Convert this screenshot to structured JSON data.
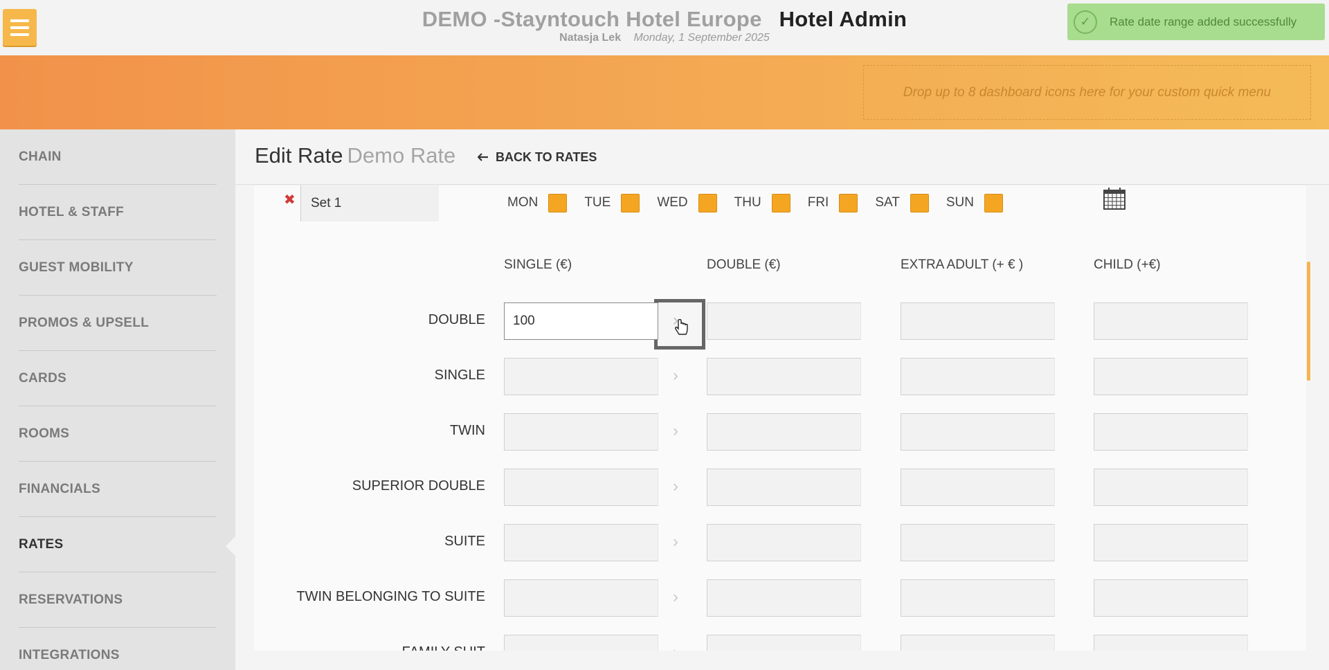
{
  "header": {
    "hotel_name": "DEMO -Stayntouch Hotel Europe",
    "app_title": "Hotel Admin",
    "user": "Natasja Lek",
    "date": "Monday, 1 September 2025"
  },
  "toast": {
    "message": "Rate date range added successfully"
  },
  "quick_menu": {
    "placeholder": "Drop up to 8 dashboard icons here for your custom quick menu"
  },
  "sidebar": {
    "items": [
      {
        "label": "CHAIN"
      },
      {
        "label": "HOTEL & STAFF"
      },
      {
        "label": "GUEST MOBILITY"
      },
      {
        "label": "PROMOS & UPSELL"
      },
      {
        "label": "CARDS"
      },
      {
        "label": "ROOMS"
      },
      {
        "label": "FINANCIALS"
      },
      {
        "label": "RATES"
      },
      {
        "label": "RESERVATIONS"
      },
      {
        "label": "INTEGRATIONS"
      }
    ],
    "active": "RATES"
  },
  "page": {
    "title": "Edit Rate",
    "rate_name": "Demo Rate",
    "back_label": "BACK TO RATES"
  },
  "set": {
    "name": "Set 1",
    "days": [
      "MON",
      "TUE",
      "WED",
      "THU",
      "FRI",
      "SAT",
      "SUN"
    ]
  },
  "table": {
    "columns": [
      "SINGLE (€)",
      "DOUBLE (€)",
      "EXTRA ADULT (+ € )",
      "CHILD (+€)"
    ],
    "rows": [
      {
        "label": "DOUBLE",
        "single": "100"
      },
      {
        "label": "SINGLE",
        "single": ""
      },
      {
        "label": "TWIN",
        "single": ""
      },
      {
        "label": "SUPERIOR DOUBLE",
        "single": ""
      },
      {
        "label": "SUITE",
        "single": ""
      },
      {
        "label": "TWIN BELONGING TO SUITE",
        "single": ""
      },
      {
        "label": "FAMILY SUIT",
        "single": ""
      }
    ]
  },
  "colors": {
    "accent_orange": "#f4a623",
    "toast_green": "#a8dc8e"
  }
}
